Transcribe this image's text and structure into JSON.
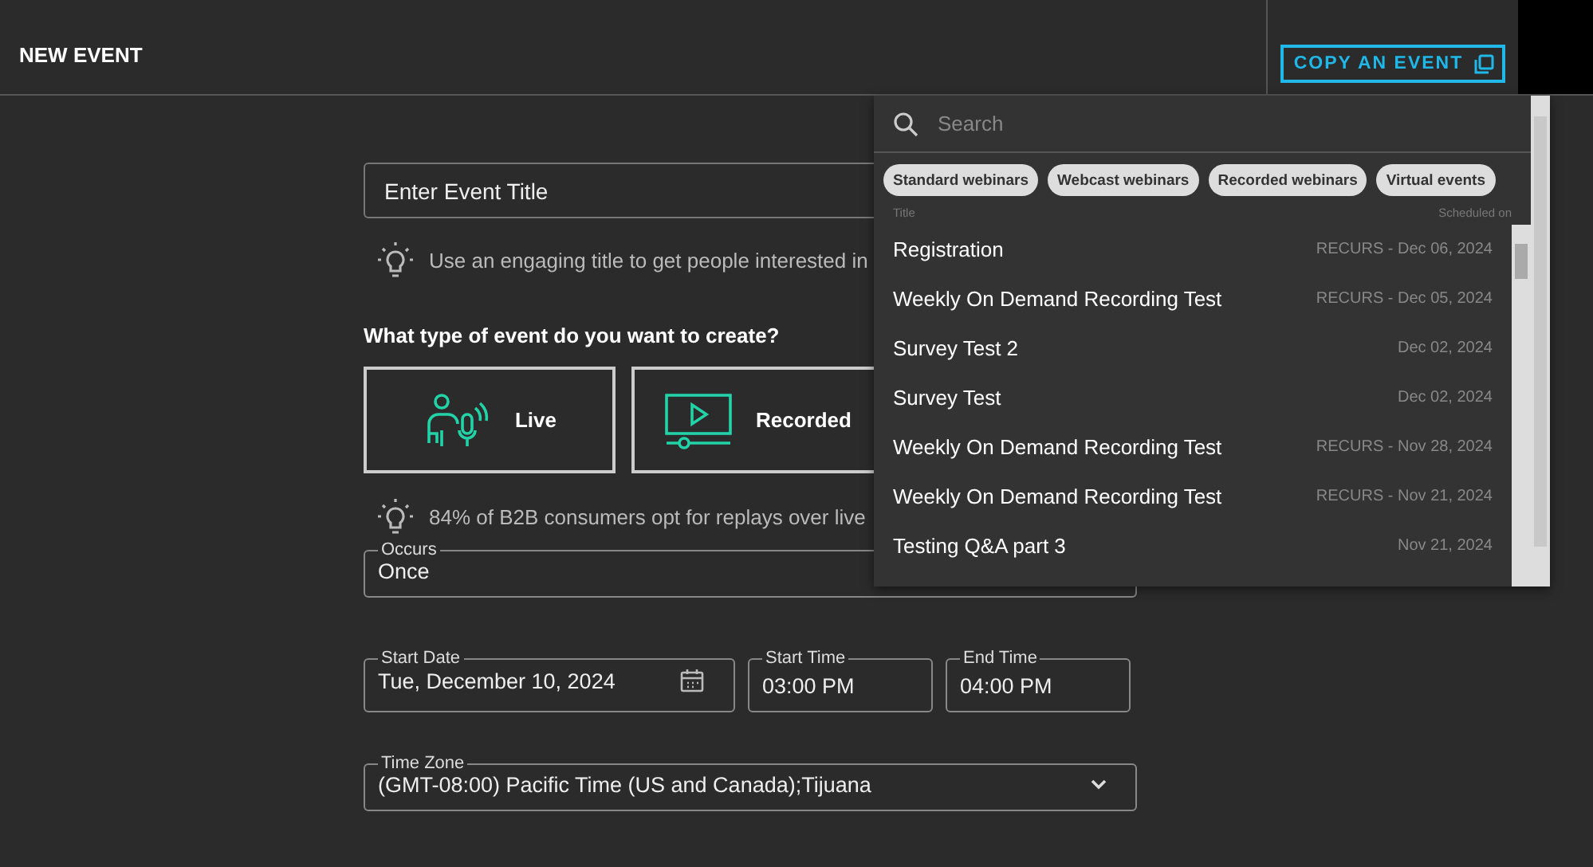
{
  "header": {
    "title": "NEW EVENT",
    "copy_button": "COPY AN EVENT"
  },
  "form": {
    "title_field": {
      "placeholder": "Enter Event Title"
    },
    "title_hint": "Use an engaging title to get people interested in",
    "type_question": "What type of event do you want to create?",
    "event_types": [
      {
        "kind": "live",
        "label": "Live"
      },
      {
        "kind": "recorded",
        "label": "Recorded"
      }
    ],
    "type_hint": "84% of B2B consumers opt for replays over live",
    "occurs": {
      "label": "Occurs",
      "value": "Once"
    },
    "start_date": {
      "label": "Start Date",
      "value": "Tue, December 10, 2024"
    },
    "start_time": {
      "label": "Start Time",
      "value": "03:00 PM"
    },
    "end_time": {
      "label": "End Time",
      "value": "04:00 PM"
    },
    "time_zone": {
      "label": "Time Zone",
      "value": "(GMT-08:00) Pacific Time (US and Canada);Tijuana"
    }
  },
  "copy_dropdown": {
    "search": {
      "placeholder": "Search"
    },
    "filters": [
      "Standard webinars",
      "Webcast webinars",
      "Recorded webinars",
      "Virtual events"
    ],
    "columns": [
      "Title",
      "Scheduled on"
    ],
    "events": [
      {
        "title": "Registration",
        "scheduled": "RECURS - Dec 06, 2024"
      },
      {
        "title": "Weekly On Demand Recording Test",
        "scheduled": "RECURS - Dec 05, 2024"
      },
      {
        "title": "Survey Test 2",
        "scheduled": "Dec 02, 2024"
      },
      {
        "title": "Survey Test",
        "scheduled": "Dec 02, 2024"
      },
      {
        "title": "Weekly On Demand Recording Test",
        "scheduled": "RECURS - Nov 28, 2024"
      },
      {
        "title": "Weekly On Demand Recording Test",
        "scheduled": "RECURS - Nov 21, 2024"
      },
      {
        "title": "Testing Q&A part 3",
        "scheduled": "Nov 21, 2024"
      }
    ]
  }
}
